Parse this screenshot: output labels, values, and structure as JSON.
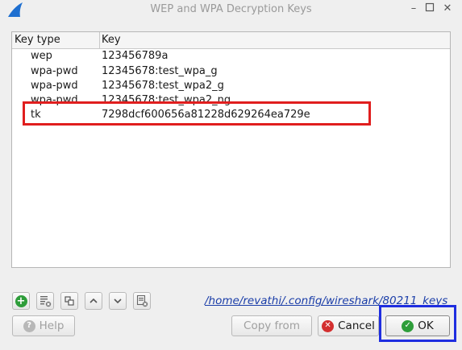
{
  "window": {
    "title": "WEP and WPA Decryption Keys"
  },
  "table": {
    "headers": [
      "Key type",
      "Key"
    ],
    "rows": [
      {
        "type": "wep",
        "key": "123456789a"
      },
      {
        "type": "wpa-pwd",
        "key": "12345678:test_wpa_g"
      },
      {
        "type": "wpa-pwd",
        "key": "12345678:test_wpa2_g"
      },
      {
        "type": "wpa-pwd",
        "key": "12345678:test_wpa2_ng"
      },
      {
        "type": "tk",
        "key": "7298dcf600656a81228d629264ea729e"
      }
    ]
  },
  "toolbar": {
    "path": "/home/revathi/.config/wireshark/80211_keys"
  },
  "buttons": {
    "help": "Help",
    "copy_from": "Copy from",
    "cancel": "Cancel",
    "ok": "OK"
  },
  "colors": {
    "highlight_red": "#e01e1e",
    "highlight_blue": "#1f2ee0",
    "ok_green": "#2e9d3a",
    "cancel_red": "#d32f2f"
  }
}
